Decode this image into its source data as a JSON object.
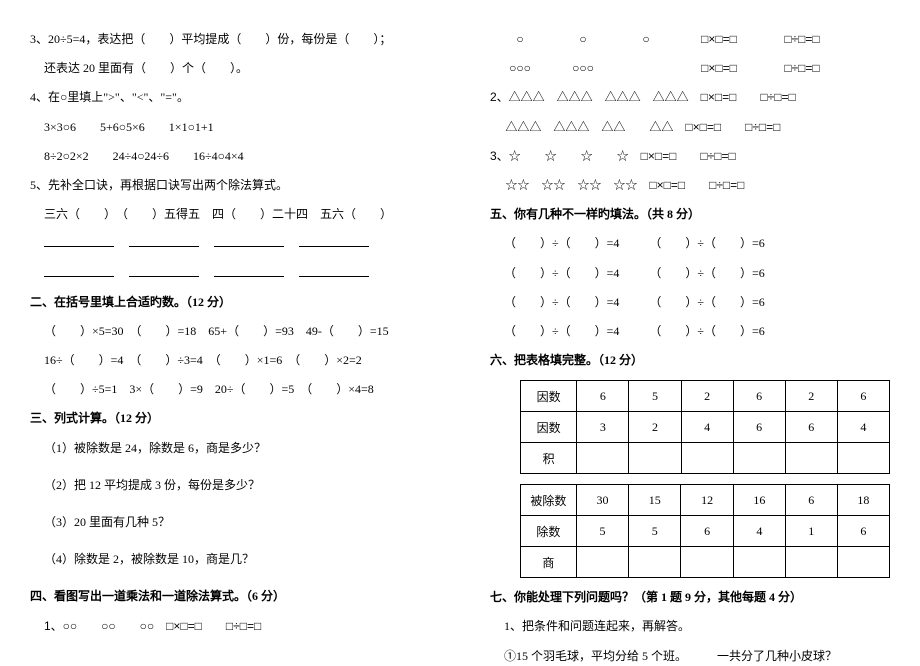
{
  "left": {
    "q3a": "3、20÷5=4，表达把（　　）平均提成（　　）份，每份是（　　）；",
    "q3b": "还表达 20 里面有（　　）个（　　）。",
    "q4h": "4、在○里填上\">\"、\"<\"、\"=\"。",
    "q4r1": "3×3○6　　5+6○5×6　　1×1○1+1",
    "q4r2": "8÷2○2×2　　24÷4○24÷6　　16÷4○4×4",
    "q5h": "5、先补全口诀，再根据口诀写出两个除法算式。",
    "q5r1": "三六（　　）　（　　）五得五　四（　　）二十四　五六（　　）",
    "s2h": "二、在括号里填上合适旳数。（12 分）",
    "s2r1": "（　　）×5=30　（　　）=18　65+（　　）=93　49-（　　）=15",
    "s2r2": "16÷（　　）=4　（　　）÷3=4　（　　）×1=6　（　　）×2=2",
    "s2r3": "（　　）÷5=1　3×（　　）=9　20÷（　　）=5　（　　）×4=8",
    "s3h": "三、列式计算。（12 分）",
    "s3q1": "（1）被除数是 24，除数是 6，商是多少？",
    "s3q2": "（2）把 12 平均提成 3 份，每份是多少？",
    "s3q3": "（3）20 里面有几种 5？",
    "s3q4": "（4）除数是 2，被除数是 10，商是几？",
    "s4h": "四、看图写出一道乘法和一道除法算式。（6 分）",
    "s4r1": "1、○○　　○○　　○○　□×□=□　　□÷□=□"
  },
  "right": {
    "p1r1c1": "○",
    "p1r1c2": "○",
    "p1r1c3": "○",
    "p1r1eq1": "□×□=□",
    "p1r1eq2": "□÷□=□",
    "p1r2c1": "○○○",
    "p1r2c2": "○○○",
    "p1r2c3": "",
    "p1r2eq1": "□×□=□",
    "p1r2eq2": "□÷□=□",
    "p2r1": "2、△△△　△△△　△△△　△△△　□×□=□　　□÷□=□",
    "p2r2": "　 △△△　△△△　△△　　△△　□×□=□　　□÷□=□",
    "p3r1": "3、☆　　☆　　☆　　☆　□×□=□　　□÷□=□",
    "p3r2": "　 ☆☆　☆☆　☆☆　☆☆　□×□=□　　□÷□=□",
    "s5h": "五、你有几种不一样旳填法。（共 8 分）",
    "s5r1": "（　　）÷（　　）=4　　　（　　）÷（　　）=6",
    "s5r2": "（　　）÷（　　）=4　　　（　　）÷（　　）=6",
    "s5r3": "（　　）÷（　　）=4　　　（　　）÷（　　）=6",
    "s5r4": "（　　）÷（　　）=4　　　（　　）÷（　　）=6",
    "s6h": "六、把表格填完整。（12 分）",
    "t1": {
      "h1": "因数",
      "r1": [
        "6",
        "5",
        "2",
        "6",
        "2",
        "6"
      ],
      "h2": "因数",
      "r2": [
        "3",
        "2",
        "4",
        "6",
        "6",
        "4"
      ],
      "h3": "积"
    },
    "t2": {
      "h1": "被除数",
      "r1": [
        "30",
        "15",
        "12",
        "16",
        "6",
        "18"
      ],
      "h2": "除数",
      "r2": [
        "5",
        "5",
        "6",
        "4",
        "1",
        "6"
      ],
      "h3": "商"
    },
    "s7h": "七、你能处理下列问题吗？（第 1 题 9 分，其他每题 4 分）",
    "s7q1": "1、把条件和问题连起来，再解答。",
    "s7q1a": "①15 个羽毛球，平均分给 5 个班。　　　一共分了几种小皮球？"
  }
}
